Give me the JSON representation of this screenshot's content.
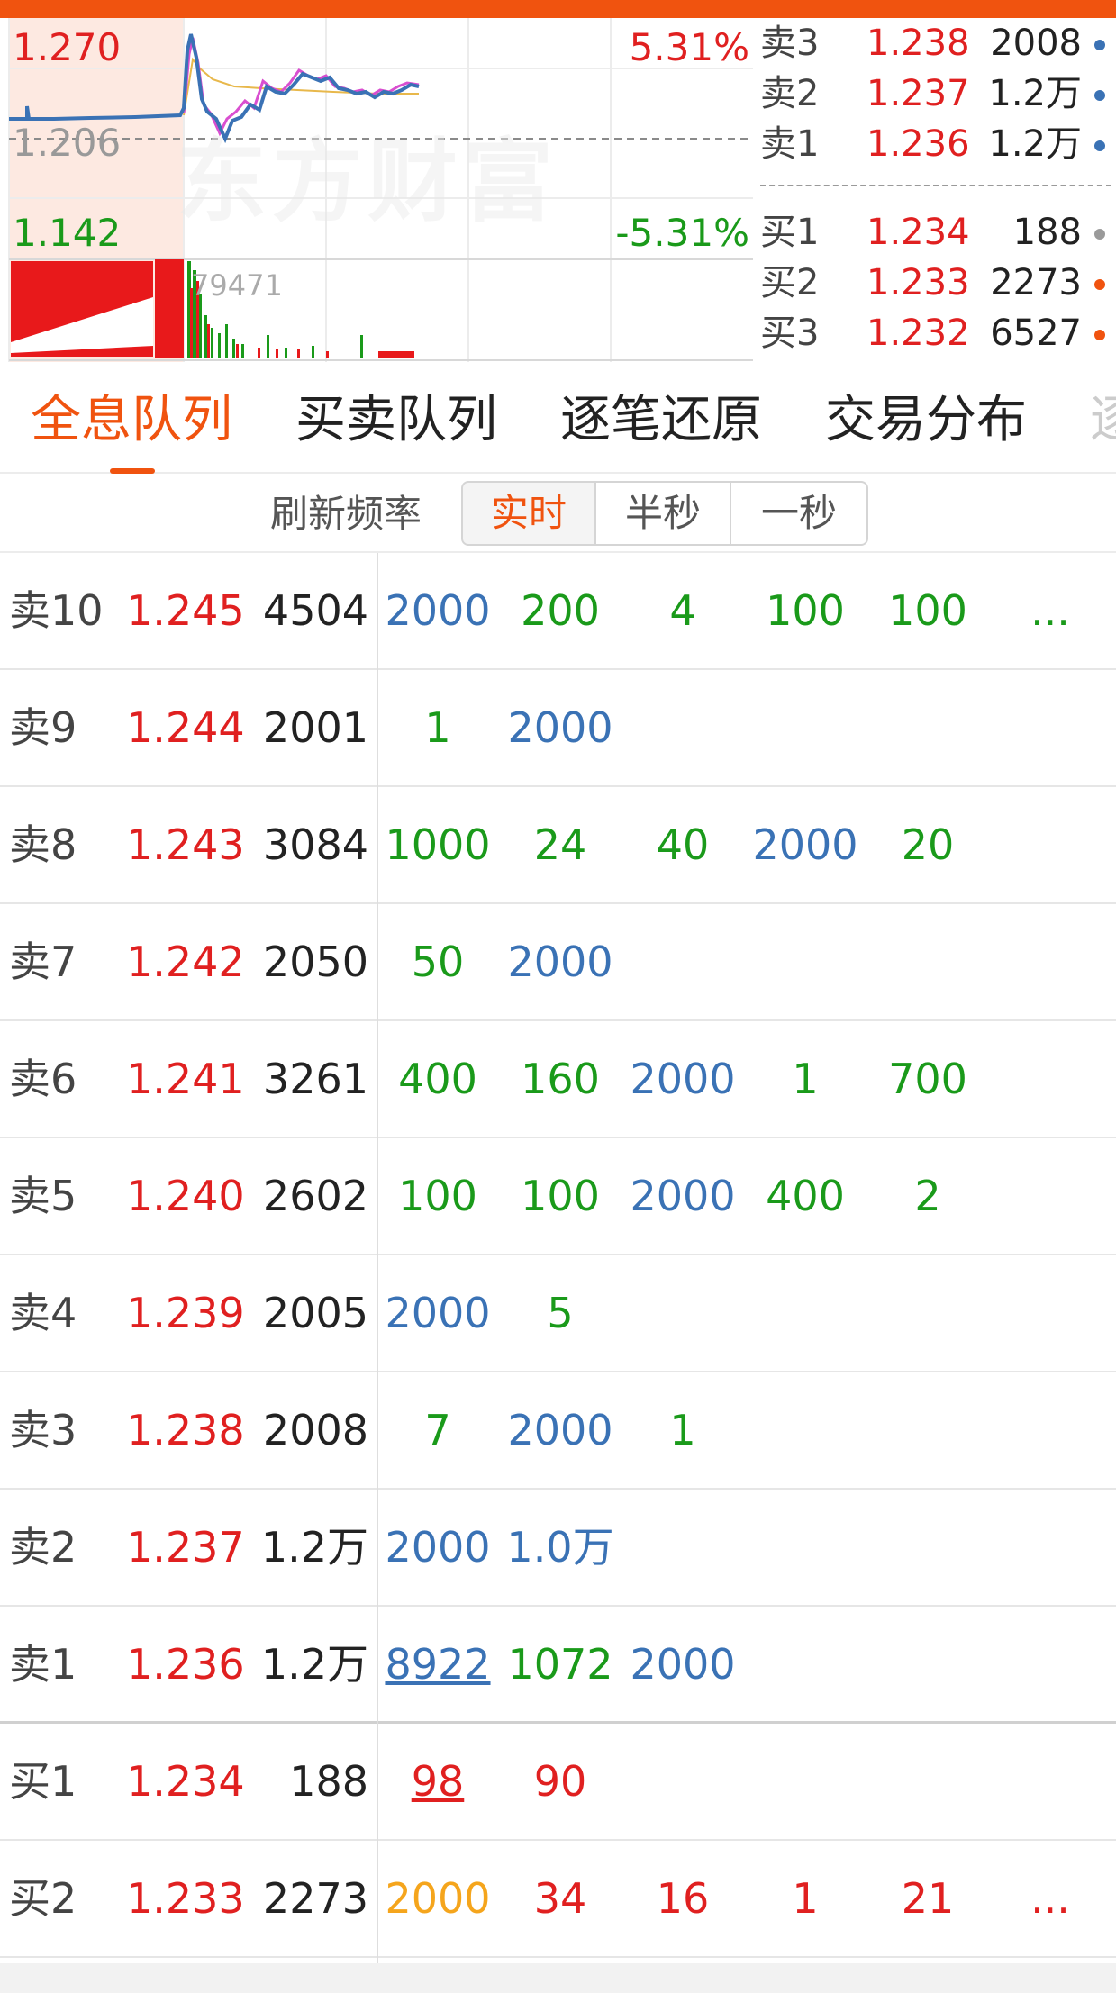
{
  "chart": {
    "high_price": "1.270",
    "base_price": "1.206",
    "low_price": "1.142",
    "high_pct": "5.31%",
    "low_pct": "-5.31%",
    "volume_label": "79471",
    "watermark": "东方财富"
  },
  "mini_book": {
    "asks": [
      {
        "side": "卖3",
        "price": "1.238",
        "volume": "2008",
        "dot_color": "#3a72b5"
      },
      {
        "side": "卖2",
        "price": "1.237",
        "volume": "1.2万",
        "dot_color": "#3a72b5"
      },
      {
        "side": "卖1",
        "price": "1.236",
        "volume": "1.2万",
        "dot_color": "#3a72b5"
      }
    ],
    "bids": [
      {
        "side": "买1",
        "price": "1.234",
        "volume": "188",
        "dot_color": "#9a9a9a"
      },
      {
        "side": "买2",
        "price": "1.233",
        "volume": "2273",
        "dot_color": "#f0530f"
      },
      {
        "side": "买3",
        "price": "1.232",
        "volume": "6527",
        "dot_color": "#f0530f"
      }
    ]
  },
  "tabs": [
    {
      "label": "全息队列",
      "active": true
    },
    {
      "label": "买卖队列",
      "active": false
    },
    {
      "label": "逐笔还原",
      "active": false
    },
    {
      "label": "交易分布",
      "active": false
    },
    {
      "label": "逐",
      "active": false
    }
  ],
  "refresh": {
    "label": "刷新频率",
    "options": [
      "实时",
      "半秒",
      "一秒"
    ],
    "selected": "实时"
  },
  "queue": [
    {
      "side": "卖10",
      "price": "1.245",
      "total": "4504",
      "orders": [
        "2000",
        "200",
        "4",
        "100",
        "100",
        "..."
      ]
    },
    {
      "side": "卖9",
      "price": "1.244",
      "total": "2001",
      "orders": [
        "1",
        "2000"
      ]
    },
    {
      "side": "卖8",
      "price": "1.243",
      "total": "3084",
      "orders": [
        "1000",
        "24",
        "40",
        "2000",
        "20"
      ]
    },
    {
      "side": "卖7",
      "price": "1.242",
      "total": "2050",
      "orders": [
        "50",
        "2000"
      ]
    },
    {
      "side": "卖6",
      "price": "1.241",
      "total": "3261",
      "orders": [
        "400",
        "160",
        "2000",
        "1",
        "700"
      ]
    },
    {
      "side": "卖5",
      "price": "1.240",
      "total": "2602",
      "orders": [
        "100",
        "100",
        "2000",
        "400",
        "2"
      ]
    },
    {
      "side": "卖4",
      "price": "1.239",
      "total": "2005",
      "orders": [
        "2000",
        "5"
      ]
    },
    {
      "side": "卖3",
      "price": "1.238",
      "total": "2008",
      "orders": [
        "7",
        "2000",
        "1"
      ]
    },
    {
      "side": "卖2",
      "price": "1.237",
      "total": "1.2万",
      "orders": [
        "2000",
        "1.0万"
      ]
    },
    {
      "side": "卖1",
      "price": "1.236",
      "total": "1.2万",
      "orders": [
        "8922",
        "1072",
        "2000"
      ]
    },
    {
      "side": "买1",
      "price": "1.234",
      "total": "188",
      "orders": [
        "98",
        "90"
      ]
    },
    {
      "side": "买2",
      "price": "1.233",
      "total": "2273",
      "orders": [
        "2000",
        "34",
        "16",
        "1",
        "21",
        "..."
      ]
    }
  ],
  "colors": {
    "accent": "#f0530f",
    "up": "#e02020",
    "down": "#1a9a1a",
    "large_order": "#3a72b5",
    "bid_large_order": "#f5a51c"
  }
}
